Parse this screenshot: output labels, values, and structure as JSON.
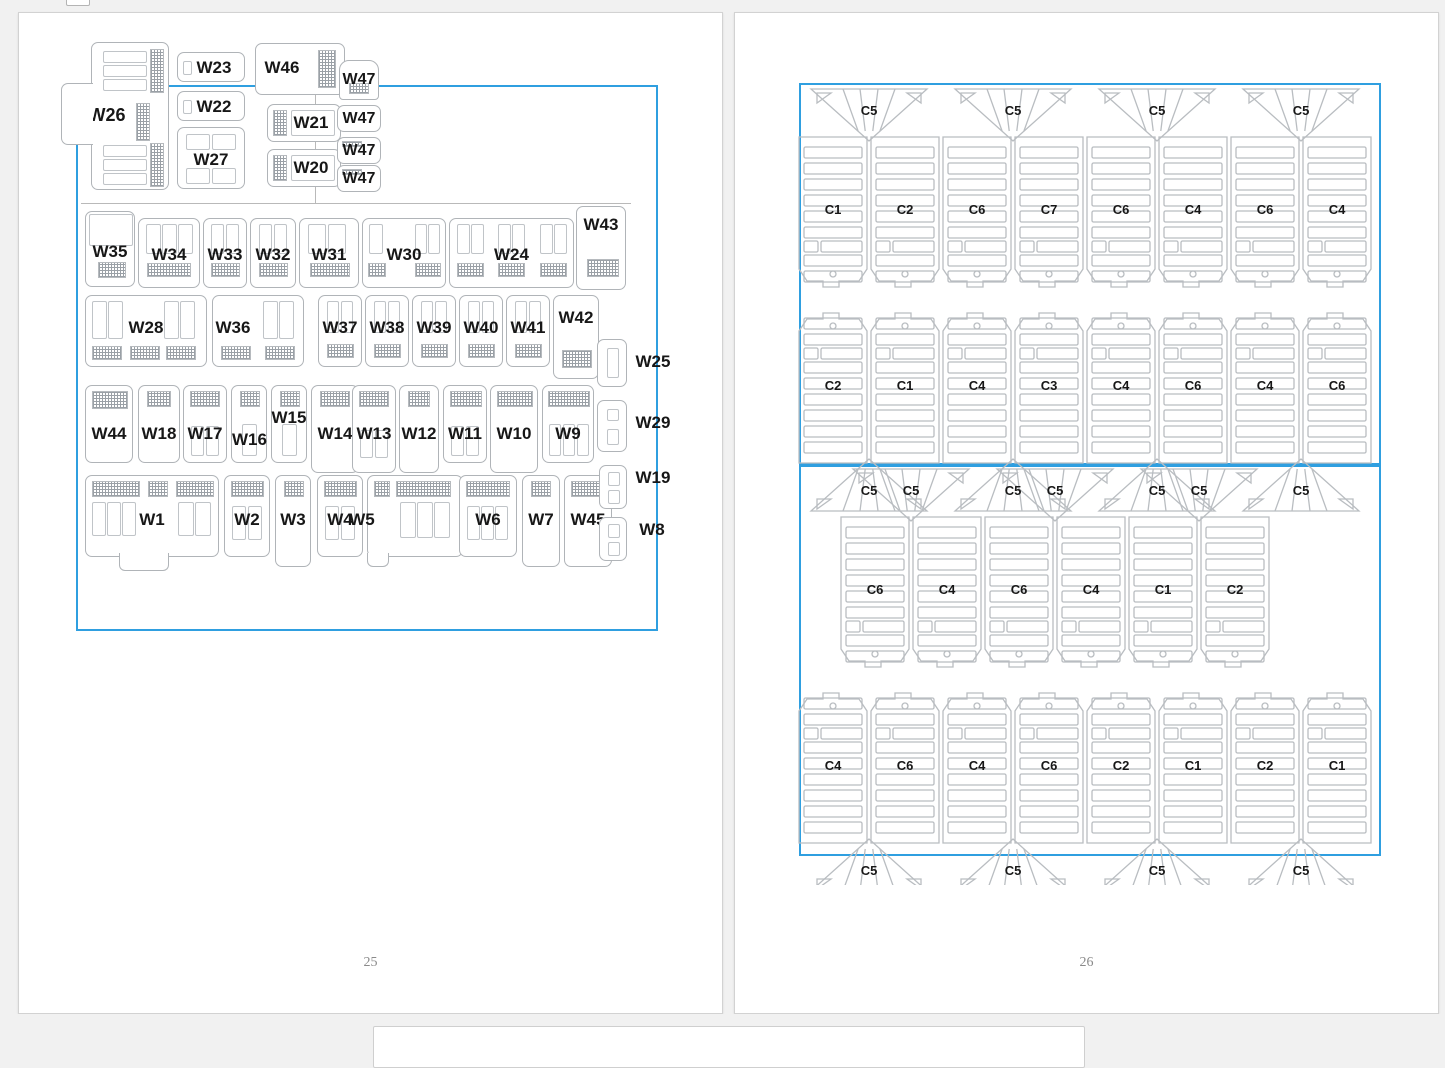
{
  "viewer": {
    "background": "#f1f1f1",
    "selection_color": "#2f9fe0",
    "outline_color": "#b0b4b8"
  },
  "pages": [
    {
      "number": "25",
      "kind": "fuse-box-diagram",
      "side": "left"
    },
    {
      "number": "26",
      "kind": "connector-diagram",
      "side": "right"
    }
  ],
  "fuse_diagram": {
    "rows": [
      {
        "name": "top-cluster",
        "fuses": [
          "W26",
          "W23",
          "W22",
          "W27",
          "W46",
          "W21",
          "W20",
          "W47",
          "W47",
          "W47",
          "W47"
        ]
      },
      {
        "name": "row-1",
        "fuses": [
          "W35",
          "W34",
          "W33",
          "W32",
          "W31",
          "W30",
          "W24",
          "W43"
        ]
      },
      {
        "name": "row-2",
        "fuses": [
          "W28",
          "W36",
          "W37",
          "W38",
          "W39",
          "W40",
          "W41",
          "W42",
          "W25"
        ]
      },
      {
        "name": "row-3",
        "fuses": [
          "W44",
          "W18",
          "W17",
          "W16",
          "W15",
          "W14",
          "W13",
          "W12",
          "W11",
          "W10",
          "W9",
          "W29"
        ]
      },
      {
        "name": "row-4",
        "fuses": [
          "W1",
          "W2",
          "W3",
          "W4",
          "W5",
          "W6",
          "W7",
          "W45",
          "W19",
          "W8"
        ]
      }
    ],
    "labels": {
      "W1": "W1",
      "W2": "W2",
      "W3": "W3",
      "W4": "W4",
      "W5": "W5",
      "W6": "W6",
      "W7": "W7",
      "W8": "W8",
      "W9": "W9",
      "W10": "W10",
      "W11": "W11",
      "W12": "W12",
      "W13": "W13",
      "W14": "W14",
      "W15": "W15",
      "W16": "W16",
      "W17": "W17",
      "W18": "W18",
      "W19": "W19",
      "W20": "W20",
      "W21": "W21",
      "W22": "W22",
      "W23": "W23",
      "W24": "W24",
      "W25": "W25",
      "W26": "W26",
      "W27": "W27",
      "W28": "W28",
      "W29": "W29",
      "W30": "W30",
      "W31": "W31",
      "W32": "W32",
      "W33": "W33",
      "W34": "W34",
      "W35": "W35",
      "W36": "W36",
      "W37": "W37",
      "W38": "W38",
      "W39": "W39",
      "W40": "W40",
      "W41": "W41",
      "W42": "W42",
      "W43": "W43",
      "W44": "W44",
      "W45": "W45",
      "W46": "W46",
      "W47": "W47"
    }
  },
  "connector_diagram": {
    "panels": [
      {
        "name": "upper-panel",
        "rows": [
          {
            "orientation": "cap-top",
            "caps": [
              "C5",
              "C5",
              "C5",
              "C5"
            ],
            "bodies": [
              "C1",
              "C2",
              "C6",
              "C7",
              "C6",
              "C4",
              "C6",
              "C4"
            ]
          },
          {
            "orientation": "cap-bottom",
            "bodies": [
              "C2",
              "C1",
              "C4",
              "C3",
              "C4",
              "C6",
              "C4",
              "C6"
            ],
            "caps": [
              "C5",
              "C5",
              "C5",
              "C5"
            ]
          }
        ]
      },
      {
        "name": "lower-panel",
        "rows": [
          {
            "orientation": "cap-top",
            "caps": [
              "C5",
              "C5",
              "C5"
            ],
            "bodies": [
              "C6",
              "C4",
              "C6",
              "C4",
              "C1",
              "C2"
            ]
          },
          {
            "orientation": "cap-bottom",
            "bodies": [
              "C4",
              "C6",
              "C4",
              "C6",
              "C2",
              "C1",
              "C2",
              "C1"
            ],
            "caps": [
              "C5",
              "C5",
              "C5",
              "C5"
            ]
          }
        ]
      }
    ],
    "labels": {
      "C1": "C1",
      "C2": "C2",
      "C3": "C3",
      "C4": "C4",
      "C5": "C5",
      "C6": "C6",
      "C7": "C7"
    }
  }
}
